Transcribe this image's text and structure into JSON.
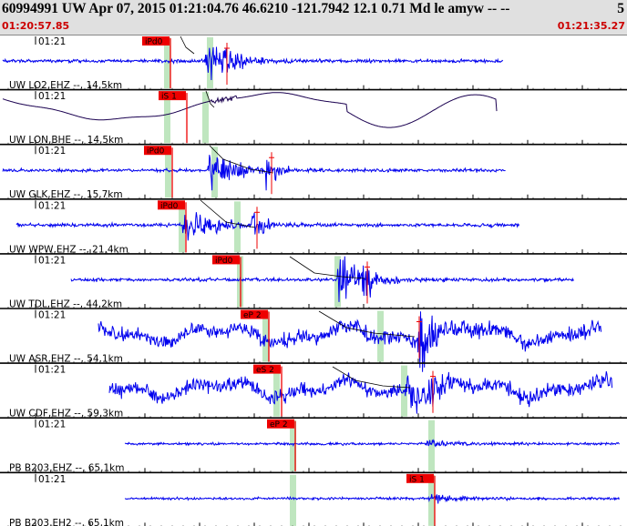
{
  "header": {
    "title": "60994991 UW Apr 07, 2015 01:21:04.76    46.6210 -121.7942 12.1 0.71 Md le amyw -- --",
    "right_value": "5",
    "start_time": "01:20:57.85",
    "end_time": "01:21:35.27"
  },
  "colors": {
    "trace": "#0000ee",
    "long_period_trace": "#1a0050",
    "pick": "#ee0000",
    "window": "#bfe6bf",
    "travel_curve": "#000000",
    "time_label": "#cc0000"
  },
  "traces": [
    {
      "label": "UW LO2,EHZ --, 14,5km",
      "time": "01:21",
      "pick": "iPd0",
      "style": "hf"
    },
    {
      "label": "UW LON,BHE --, 14,5km",
      "time": "01:21",
      "pick": "iS 1",
      "style": "lp"
    },
    {
      "label": "UW GLK,EHZ --, 15,7km",
      "time": "01:21",
      "pick": "iPd0",
      "style": "hf"
    },
    {
      "label": "UW WPW,EHZ --, 21,4km",
      "time": "01:21",
      "pick": "iPd0",
      "style": "hf"
    },
    {
      "label": "UW TDL,EHZ --, 44,2km",
      "time": "01:21",
      "pick": "iPd0",
      "style": "hf"
    },
    {
      "label": "UW ASR,EHZ --, 54,1km",
      "time": "01:21",
      "pick": "eP 2",
      "style": "noisy"
    },
    {
      "label": "UW CDF,EHZ --, 59,3km",
      "time": "01:21",
      "pick": "eS 2",
      "style": "noisy"
    },
    {
      "label": "PB B203,EHZ --, 65,1km",
      "time": "01:21",
      "pick": "eP 2",
      "style": "quiet"
    },
    {
      "label": "PB B203,EH2 --, 65,1km",
      "time": "01:21",
      "pick": "iS 1",
      "style": "quiet"
    }
  ]
}
